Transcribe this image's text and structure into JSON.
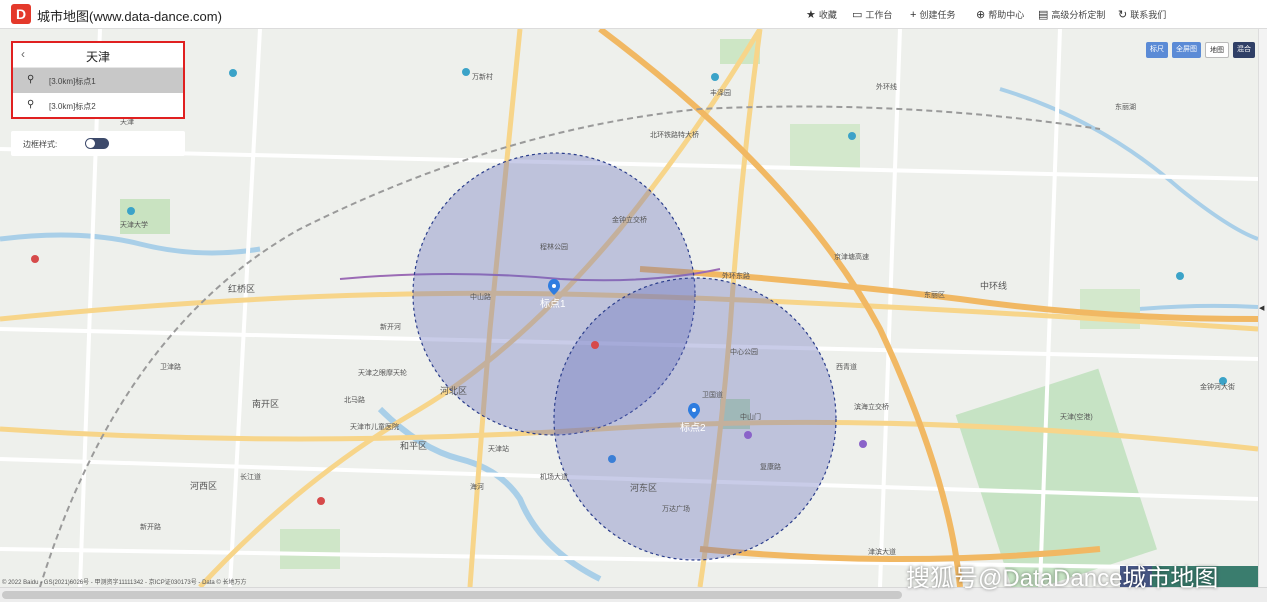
{
  "app": {
    "title": "城市地图(www.data-dance.com)",
    "logo": "D"
  },
  "toolbar": [
    {
      "icon": "★",
      "label": "收藏"
    },
    {
      "icon": "▭",
      "label": "工作台"
    },
    {
      "icon": "+",
      "label": "创建任务"
    },
    {
      "icon": "⊕",
      "label": "帮助中心"
    },
    {
      "icon": "▤",
      "label": "高级分析定制"
    },
    {
      "icon": "↻",
      "label": "联系我们"
    }
  ],
  "panel": {
    "city": "天津",
    "back_icon": "‹",
    "points": [
      {
        "label": "[3.0km]标点1",
        "selected": true
      },
      {
        "label": "[3.0km]标点2",
        "selected": false
      }
    ],
    "style_label": "边框样式:",
    "toggle_on": true
  },
  "map_controls": [
    "标尺",
    "全屏图",
    "地图",
    "混合"
  ],
  "circles": [
    {
      "marker_label": "标点1"
    },
    {
      "marker_label": "标点2"
    }
  ],
  "map_labels": [
    "天津",
    "外环东路",
    "外环线",
    "京津塘高速",
    "北环铁路特大桥",
    "金钟立交桥",
    "中心公园",
    "河北区",
    "河东区",
    "和平区",
    "红桥区",
    "河西区",
    "南开区",
    "卫国道",
    "津滨大道",
    "天津站",
    "天津大学",
    "天津之眼摩天轮",
    "海河",
    "长江道",
    "北马路",
    "中山路",
    "万达广场",
    "万新村",
    "丰泽园",
    "东丽湖",
    "金钟河大街",
    "天津(空港)",
    "机场大道",
    "新开路",
    "卫津路",
    "天津市儿童医院",
    "西青道",
    "中环线",
    "东丽区",
    "滨海立交桥",
    "复康路",
    "中山门",
    "程林公园",
    "新开河"
  ],
  "copyright": "© 2022 Baidu - GS(2021)6026号 - 甲测资字11111342 - 京ICP证030173号 - Data © 长地万方",
  "watermark": "搜狐号@DataDance城市地图"
}
